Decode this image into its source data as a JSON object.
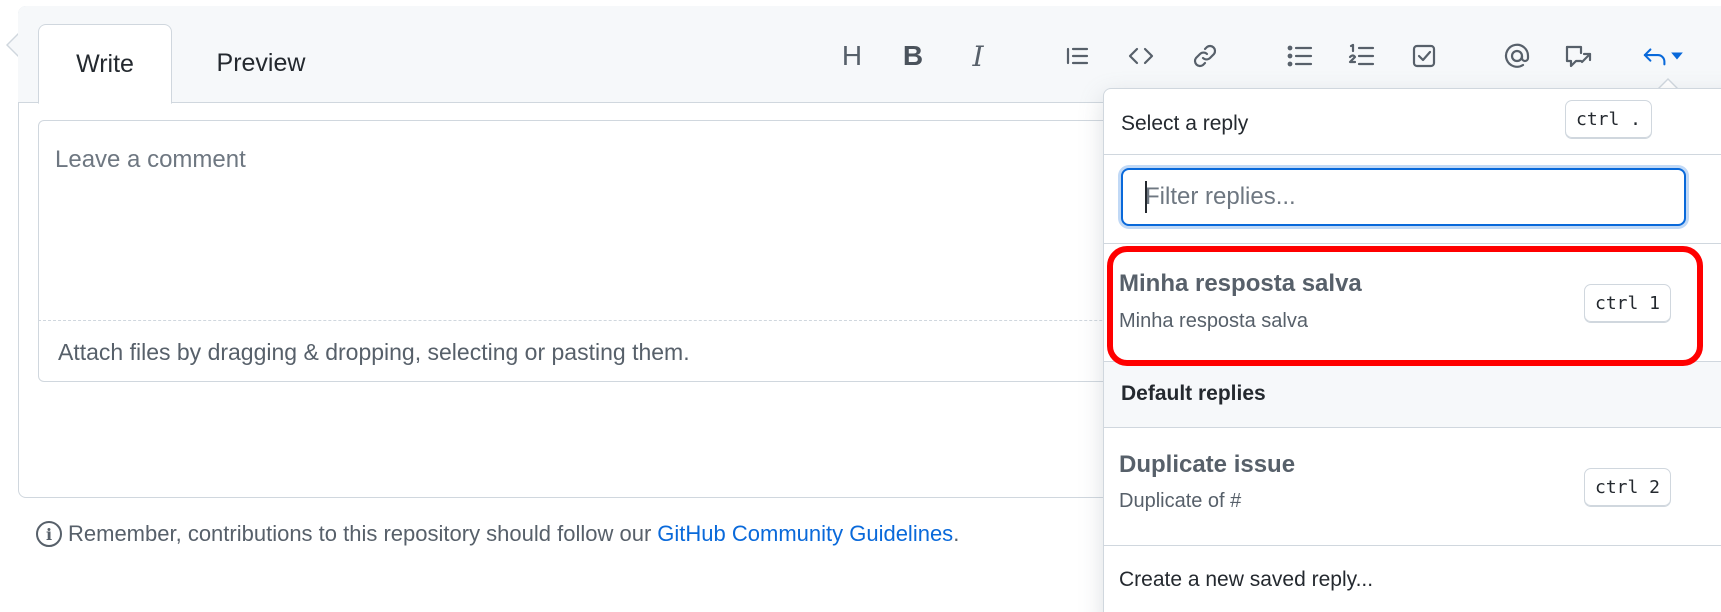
{
  "tabs": {
    "write": "Write",
    "preview": "Preview"
  },
  "toolbar": {
    "heading": "H",
    "bold": "B",
    "italic": "I",
    "items": [
      "heading-icon",
      "bold-icon",
      "italic-icon",
      "quote-icon",
      "code-icon",
      "link-icon",
      "unordered-list-icon",
      "ordered-list-icon",
      "task-list-icon",
      "mention-icon",
      "cross-reference-icon",
      "reply-icon"
    ]
  },
  "editor": {
    "placeholder": "Leave a comment",
    "attach_text": "Attach files by dragging & dropping, selecting or pasting them."
  },
  "footer": {
    "note": "Remember, contributions to this repository should follow our",
    "link": "GitHub Community Guidelines",
    "suffix": ".",
    "info_icon_glyph": "i"
  },
  "saved_replies": {
    "title": "Select a reply",
    "shortcut": "ctrl .",
    "filter_placeholder": "Filter replies...",
    "user_replies": [
      {
        "name": "Minha resposta salva",
        "body": "Minha resposta salva",
        "shortcut": "ctrl 1"
      }
    ],
    "default_section_title": "Default replies",
    "default_replies": [
      {
        "name": "Duplicate issue",
        "body": "Duplicate of #",
        "shortcut": "ctrl 2"
      }
    ],
    "create_new": "Create a new saved reply..."
  },
  "colors": {
    "accent": "#0969da",
    "highlight": "#ff0000",
    "border": "#d0d7de",
    "muted_bg": "#f6f8fa"
  }
}
